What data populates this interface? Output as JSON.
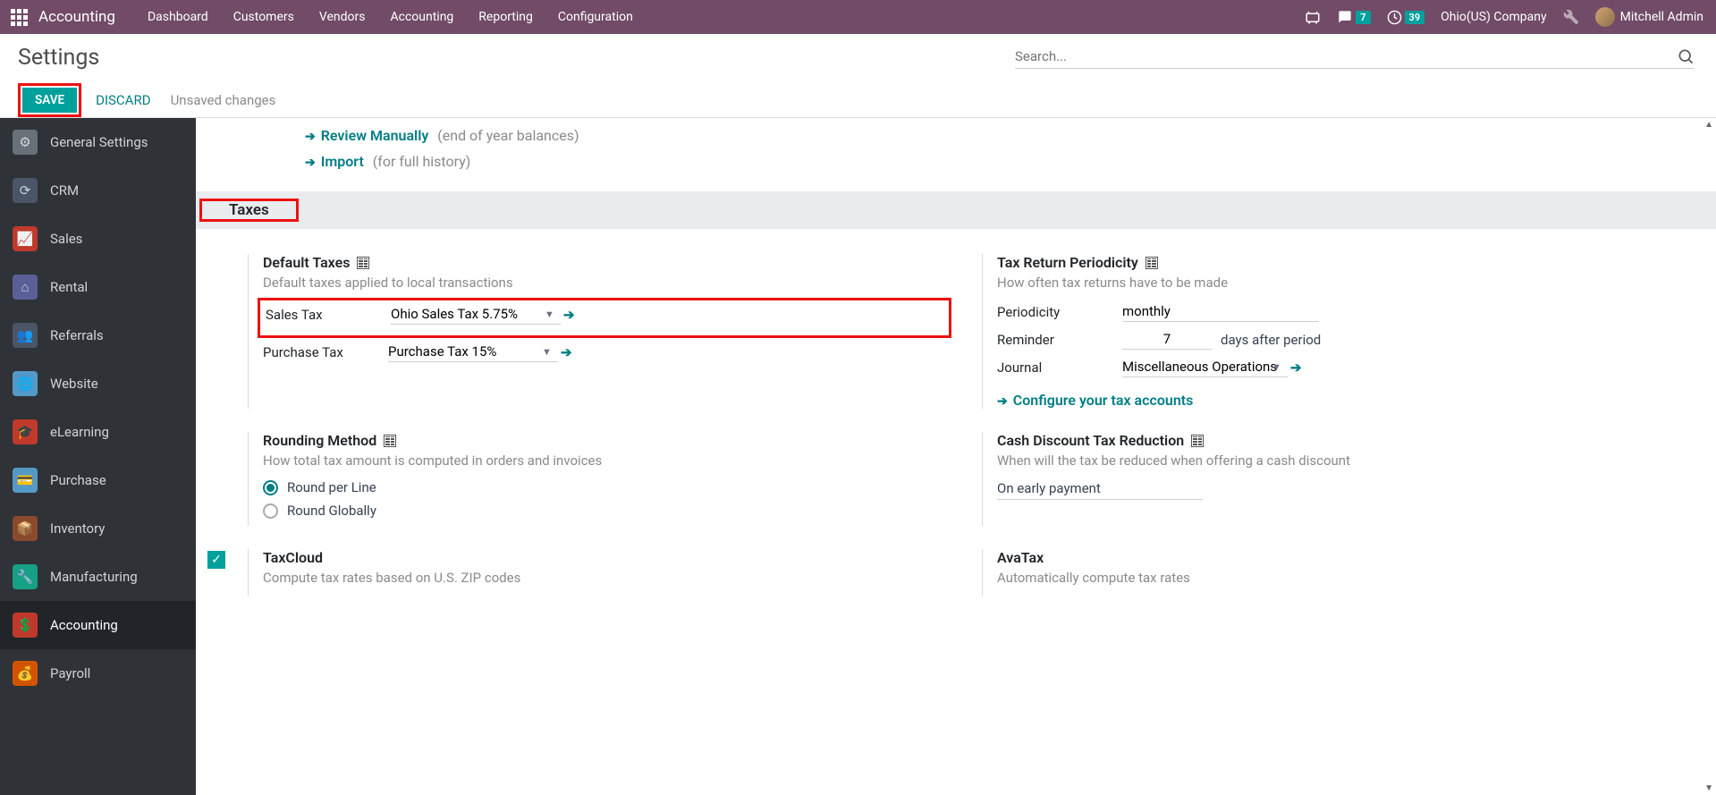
{
  "topbar": {
    "app": "Accounting",
    "nav": [
      "Dashboard",
      "Customers",
      "Vendors",
      "Accounting",
      "Reporting",
      "Configuration"
    ],
    "msg_badge": "7",
    "clock_badge": "39",
    "company": "Ohio(US) Company",
    "user": "Mitchell Admin"
  },
  "page": {
    "title": "Settings",
    "save": "SAVE",
    "discard": "DISCARD",
    "unsaved": "Unsaved changes",
    "search_placeholder": "Search..."
  },
  "sidebar": [
    {
      "label": "General Settings",
      "cls": "i-gear"
    },
    {
      "label": "CRM",
      "cls": "i-crm"
    },
    {
      "label": "Sales",
      "cls": "i-sales"
    },
    {
      "label": "Rental",
      "cls": "i-rental"
    },
    {
      "label": "Referrals",
      "cls": "i-ref"
    },
    {
      "label": "Website",
      "cls": "i-web"
    },
    {
      "label": "eLearning",
      "cls": "i-elr"
    },
    {
      "label": "Purchase",
      "cls": "i-pur"
    },
    {
      "label": "Inventory",
      "cls": "i-inv"
    },
    {
      "label": "Manufacturing",
      "cls": "i-mfg"
    },
    {
      "label": "Accounting",
      "cls": "i-acc",
      "active": true
    },
    {
      "label": "Payroll",
      "cls": "i-pay"
    }
  ],
  "links": {
    "review": "Review Manually",
    "review_desc": "(end of year balances)",
    "import": "Import",
    "import_desc": "(for full history)"
  },
  "taxes_header": "Taxes",
  "default_taxes": {
    "title": "Default Taxes",
    "desc": "Default taxes applied to local transactions",
    "sales_label": "Sales Tax",
    "sales_value": "Ohio Sales Tax 5.75%",
    "purchase_label": "Purchase Tax",
    "purchase_value": "Purchase Tax 15%"
  },
  "periodicity": {
    "title": "Tax Return Periodicity",
    "desc": "How often tax returns have to be made",
    "per_label": "Periodicity",
    "per_value": "monthly",
    "rem_label": "Reminder",
    "rem_value": "7",
    "rem_after": "days after period",
    "jrn_label": "Journal",
    "jrn_value": "Miscellaneous Operations",
    "config_link": "Configure your tax accounts"
  },
  "rounding": {
    "title": "Rounding Method",
    "desc": "How total tax amount is computed in orders and invoices",
    "opt1": "Round per Line",
    "opt2": "Round Globally"
  },
  "cash_discount": {
    "title": "Cash Discount Tax Reduction",
    "desc": "When will the tax be reduced when offering a cash discount",
    "value": "On early payment"
  },
  "taxcloud": {
    "title": "TaxCloud",
    "desc": "Compute tax rates based on U.S. ZIP codes"
  },
  "avatax": {
    "title": "AvaTax",
    "desc": "Automatically compute tax rates"
  }
}
